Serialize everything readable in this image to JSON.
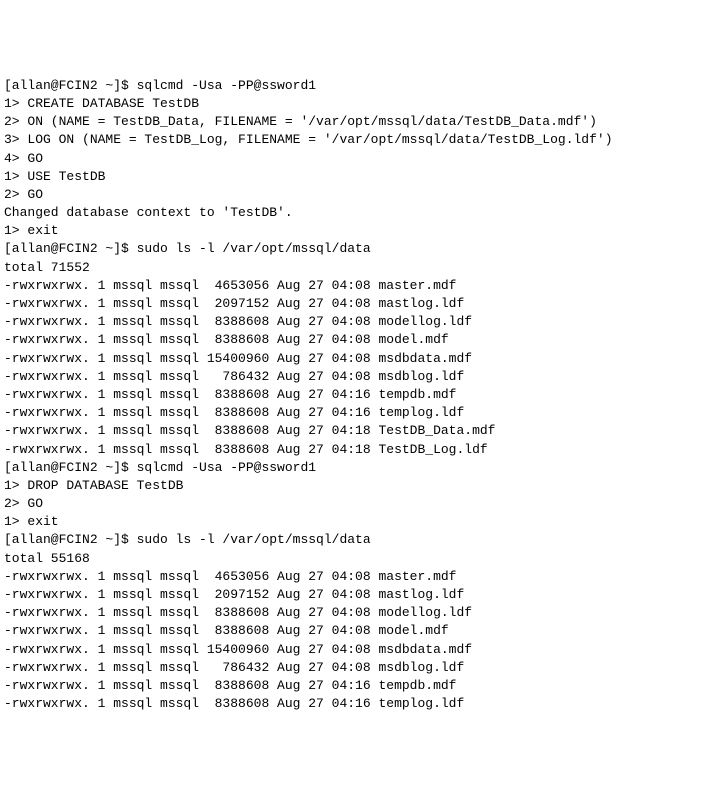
{
  "terminal": {
    "lines": [
      "[allan@FCIN2 ~]$ sqlcmd -Usa -PP@ssword1",
      "1> CREATE DATABASE TestDB",
      "2> ON (NAME = TestDB_Data, FILENAME = '/var/opt/mssql/data/TestDB_Data.mdf')",
      "3> LOG ON (NAME = TestDB_Log, FILENAME = '/var/opt/mssql/data/TestDB_Log.ldf')",
      "4> GO",
      "1> USE TestDB",
      "2> GO",
      "Changed database context to 'TestDB'.",
      "1> exit",
      "[allan@FCIN2 ~]$ sudo ls -l /var/opt/mssql/data",
      "total 71552",
      "-rwxrwxrwx. 1 mssql mssql  4653056 Aug 27 04:08 master.mdf",
      "-rwxrwxrwx. 1 mssql mssql  2097152 Aug 27 04:08 mastlog.ldf",
      "-rwxrwxrwx. 1 mssql mssql  8388608 Aug 27 04:08 modellog.ldf",
      "-rwxrwxrwx. 1 mssql mssql  8388608 Aug 27 04:08 model.mdf",
      "-rwxrwxrwx. 1 mssql mssql 15400960 Aug 27 04:08 msdbdata.mdf",
      "-rwxrwxrwx. 1 mssql mssql   786432 Aug 27 04:08 msdblog.ldf",
      "-rwxrwxrwx. 1 mssql mssql  8388608 Aug 27 04:16 tempdb.mdf",
      "-rwxrwxrwx. 1 mssql mssql  8388608 Aug 27 04:16 templog.ldf",
      "-rwxrwxrwx. 1 mssql mssql  8388608 Aug 27 04:18 TestDB_Data.mdf",
      "-rwxrwxrwx. 1 mssql mssql  8388608 Aug 27 04:18 TestDB_Log.ldf",
      "[allan@FCIN2 ~]$ sqlcmd -Usa -PP@ssword1",
      "1> DROP DATABASE TestDB",
      "2> GO",
      "1> exit",
      "[allan@FCIN2 ~]$ sudo ls -l /var/opt/mssql/data",
      "total 55168",
      "-rwxrwxrwx. 1 mssql mssql  4653056 Aug 27 04:08 master.mdf",
      "-rwxrwxrwx. 1 mssql mssql  2097152 Aug 27 04:08 mastlog.ldf",
      "-rwxrwxrwx. 1 mssql mssql  8388608 Aug 27 04:08 modellog.ldf",
      "-rwxrwxrwx. 1 mssql mssql  8388608 Aug 27 04:08 model.mdf",
      "-rwxrwxrwx. 1 mssql mssql 15400960 Aug 27 04:08 msdbdata.mdf",
      "-rwxrwxrwx. 1 mssql mssql   786432 Aug 27 04:08 msdblog.ldf",
      "-rwxrwxrwx. 1 mssql mssql  8388608 Aug 27 04:16 tempdb.mdf",
      "-rwxrwxrwx. 1 mssql mssql  8388608 Aug 27 04:16 templog.ldf"
    ]
  }
}
